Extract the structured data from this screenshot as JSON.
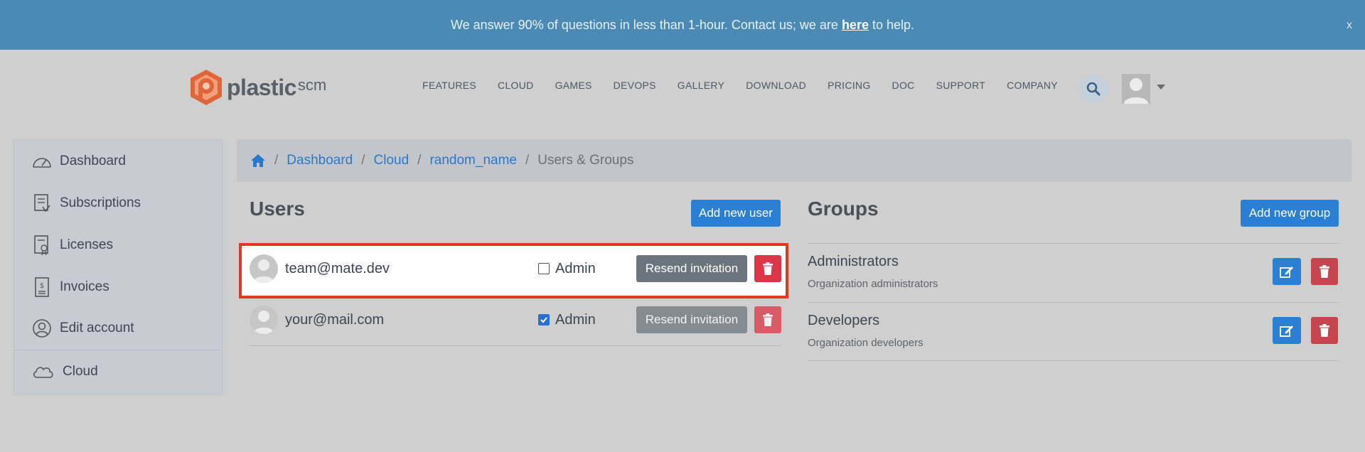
{
  "banner": {
    "text_before": "We answer 90% of questions in less than 1-hour. Contact us; we are ",
    "link": "here",
    "text_after": " to help.",
    "close": "x"
  },
  "header": {
    "logo_word": "plastic",
    "logo_suffix": "scm",
    "nav": [
      "FEATURES",
      "CLOUD",
      "GAMES",
      "DEVOPS",
      "GALLERY",
      "DOWNLOAD",
      "PRICING",
      "DOC",
      "SUPPORT",
      "COMPANY"
    ]
  },
  "sidebar": {
    "items": [
      {
        "label": "Dashboard",
        "icon": "gauge-icon"
      },
      {
        "label": "Subscriptions",
        "icon": "subscriptions-icon"
      },
      {
        "label": "Licenses",
        "icon": "license-icon"
      },
      {
        "label": "Invoices",
        "icon": "invoice-icon"
      },
      {
        "label": "Edit account",
        "icon": "user-circle-icon"
      },
      {
        "label": "Cloud",
        "icon": "cloud-icon"
      }
    ]
  },
  "breadcrumb": {
    "items": [
      "Dashboard",
      "Cloud",
      "random_name"
    ],
    "current": "Users & Groups",
    "separator": "/"
  },
  "users": {
    "title": "Users",
    "add_label": "Add new user",
    "admin_label": "Admin",
    "resend_label": "Resend invitation",
    "rows": [
      {
        "email": "team@mate.dev",
        "admin": false
      },
      {
        "email": "your@mail.com",
        "admin": true
      }
    ]
  },
  "groups": {
    "title": "Groups",
    "add_label": "Add new group",
    "rows": [
      {
        "name": "Administrators",
        "description": "Organization administrators"
      },
      {
        "name": "Developers",
        "description": "Organization developers"
      }
    ]
  },
  "colors": {
    "banner": "#4a8ab5",
    "primary": "#2a7fd4",
    "danger": "#dc3545",
    "highlight": "#e0391f",
    "secondary": "#6c757d"
  }
}
